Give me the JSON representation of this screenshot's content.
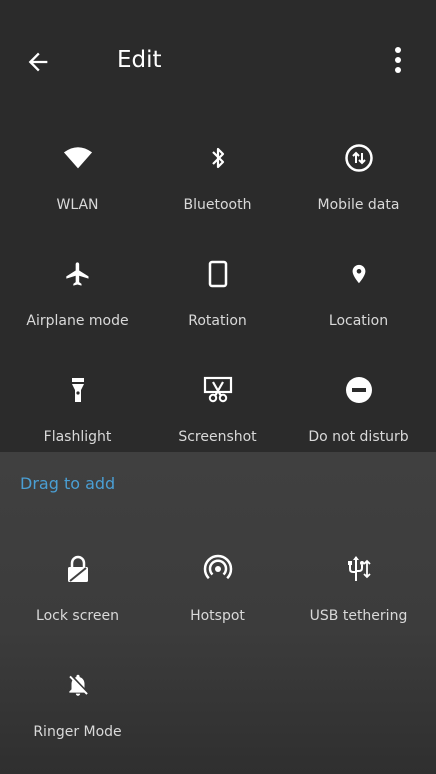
{
  "toolbar": {
    "title": "Edit",
    "back_icon": "arrow-left-icon",
    "more_icon": "more-vertical-icon"
  },
  "active_tiles": [
    {
      "label": "WLAN",
      "icon": "wifi-icon"
    },
    {
      "label": "Bluetooth",
      "icon": "bluetooth-icon"
    },
    {
      "label": "Mobile data",
      "icon": "mobile-data-icon"
    },
    {
      "label": "Airplane mode",
      "icon": "airplane-icon"
    },
    {
      "label": "Rotation",
      "icon": "phone-rotation-icon"
    },
    {
      "label": "Location",
      "icon": "location-pin-icon"
    },
    {
      "label": "Flashlight",
      "icon": "flashlight-icon"
    },
    {
      "label": "Screenshot",
      "icon": "screenshot-icon"
    },
    {
      "label": "Do not disturb",
      "icon": "do-not-disturb-icon"
    }
  ],
  "drag_to_add": {
    "label": "Drag to add",
    "color": "#4a9fd4"
  },
  "available_tiles": [
    {
      "label": "Lock screen",
      "icon": "lock-icon"
    },
    {
      "label": "Hotspot",
      "icon": "hotspot-icon"
    },
    {
      "label": "USB tethering",
      "icon": "usb-icon"
    },
    {
      "label": "Ringer Mode",
      "icon": "bell-off-icon"
    }
  ],
  "colors": {
    "background": "#2b2b2b",
    "tray_background": "#404040",
    "label_text": "#d9d9d9",
    "accent": "#4a9fd4"
  }
}
